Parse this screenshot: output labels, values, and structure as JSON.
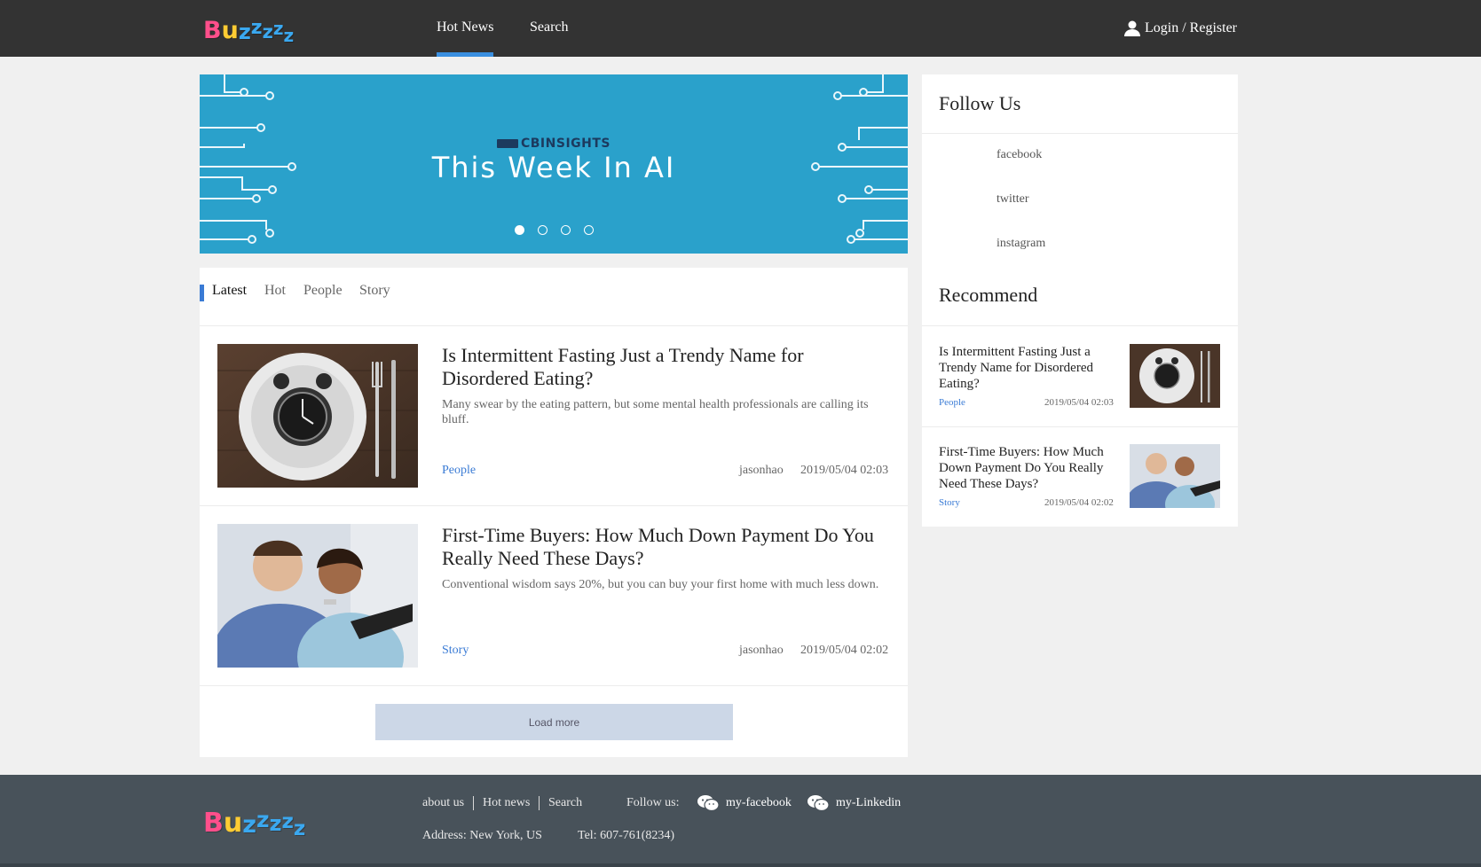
{
  "header": {
    "logo_text": "Buzzzzz",
    "nav": [
      {
        "label": "Hot News",
        "active": true
      },
      {
        "label": "Search",
        "active": false
      }
    ],
    "login_label": "Login / Register"
  },
  "banner": {
    "brand": "CBINSIGHTS",
    "title": "This Week In AI",
    "slide_count": 4,
    "active_slide": 1,
    "background_color": "#2aa1cb"
  },
  "tabs": [
    {
      "label": "Latest",
      "active": true
    },
    {
      "label": "Hot",
      "active": false
    },
    {
      "label": "People",
      "active": false
    },
    {
      "label": "Story",
      "active": false
    }
  ],
  "articles": [
    {
      "title": "Is Intermittent Fasting Just a Trendy Name for Disordered Eating?",
      "description": "Many swear by the eating pattern, but some mental health professionals are calling its bluff.",
      "category": "People",
      "author": "jasonhao",
      "date": "2019/05/04 02:03",
      "image": "clock-on-plate"
    },
    {
      "title": "First-Time Buyers: How Much Down Payment Do You Really Need These Days?",
      "description": "Conventional wisdom says 20%, but you can buy your first home with much less down.",
      "category": "Story",
      "author": "jasonhao",
      "date": "2019/05/04 02:02",
      "image": "couple-with-keys"
    }
  ],
  "load_more_label": "Load more",
  "sidebar": {
    "follow_title": "Follow Us",
    "social_links": [
      "facebook",
      "twitter",
      "instagram"
    ],
    "recommend_title": "Recommend",
    "recommend": [
      {
        "title": "Is Intermittent Fasting Just a Trendy Name for Disordered Eating?",
        "category": "People",
        "date": "2019/05/04 02:03"
      },
      {
        "title": "First-Time Buyers: How Much Down Payment Do You Really Need These Days?",
        "category": "Story",
        "date": "2019/05/04 02:02"
      }
    ]
  },
  "footer": {
    "logo_text": "Buzzzzz",
    "links": [
      "about us",
      "Hot news",
      "Search"
    ],
    "follow_label": "Follow us:",
    "social": [
      "my-facebook",
      "my-Linkedin"
    ],
    "address": "Address: New York, US",
    "tel": "Tel: 607-761(8234)"
  },
  "colors": {
    "header_bg": "#333333",
    "accent": "#3a7bd5",
    "footer_bg": "#48525a"
  }
}
